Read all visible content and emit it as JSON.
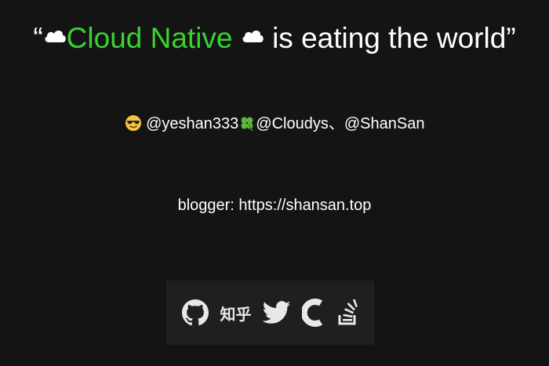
{
  "headline": {
    "open_quote": "“",
    "highlight": "Cloud Native",
    "rest": "is eating the world",
    "close_quote": "”",
    "highlight_color": "#39d232"
  },
  "authors": {
    "handle1": "@yeshan333",
    "handle2": "@Cloudys、@ShanSan",
    "icons": [
      "sunglasses-face-icon",
      "four-leaf-clover-icon"
    ]
  },
  "blog": {
    "label": "blogger: https://shansan.top"
  },
  "social": {
    "zhihu_label": "知乎",
    "icons": [
      "github-icon",
      "zhihu-icon",
      "twitter-icon",
      "csdn-icon",
      "stackoverflow-icon"
    ]
  }
}
